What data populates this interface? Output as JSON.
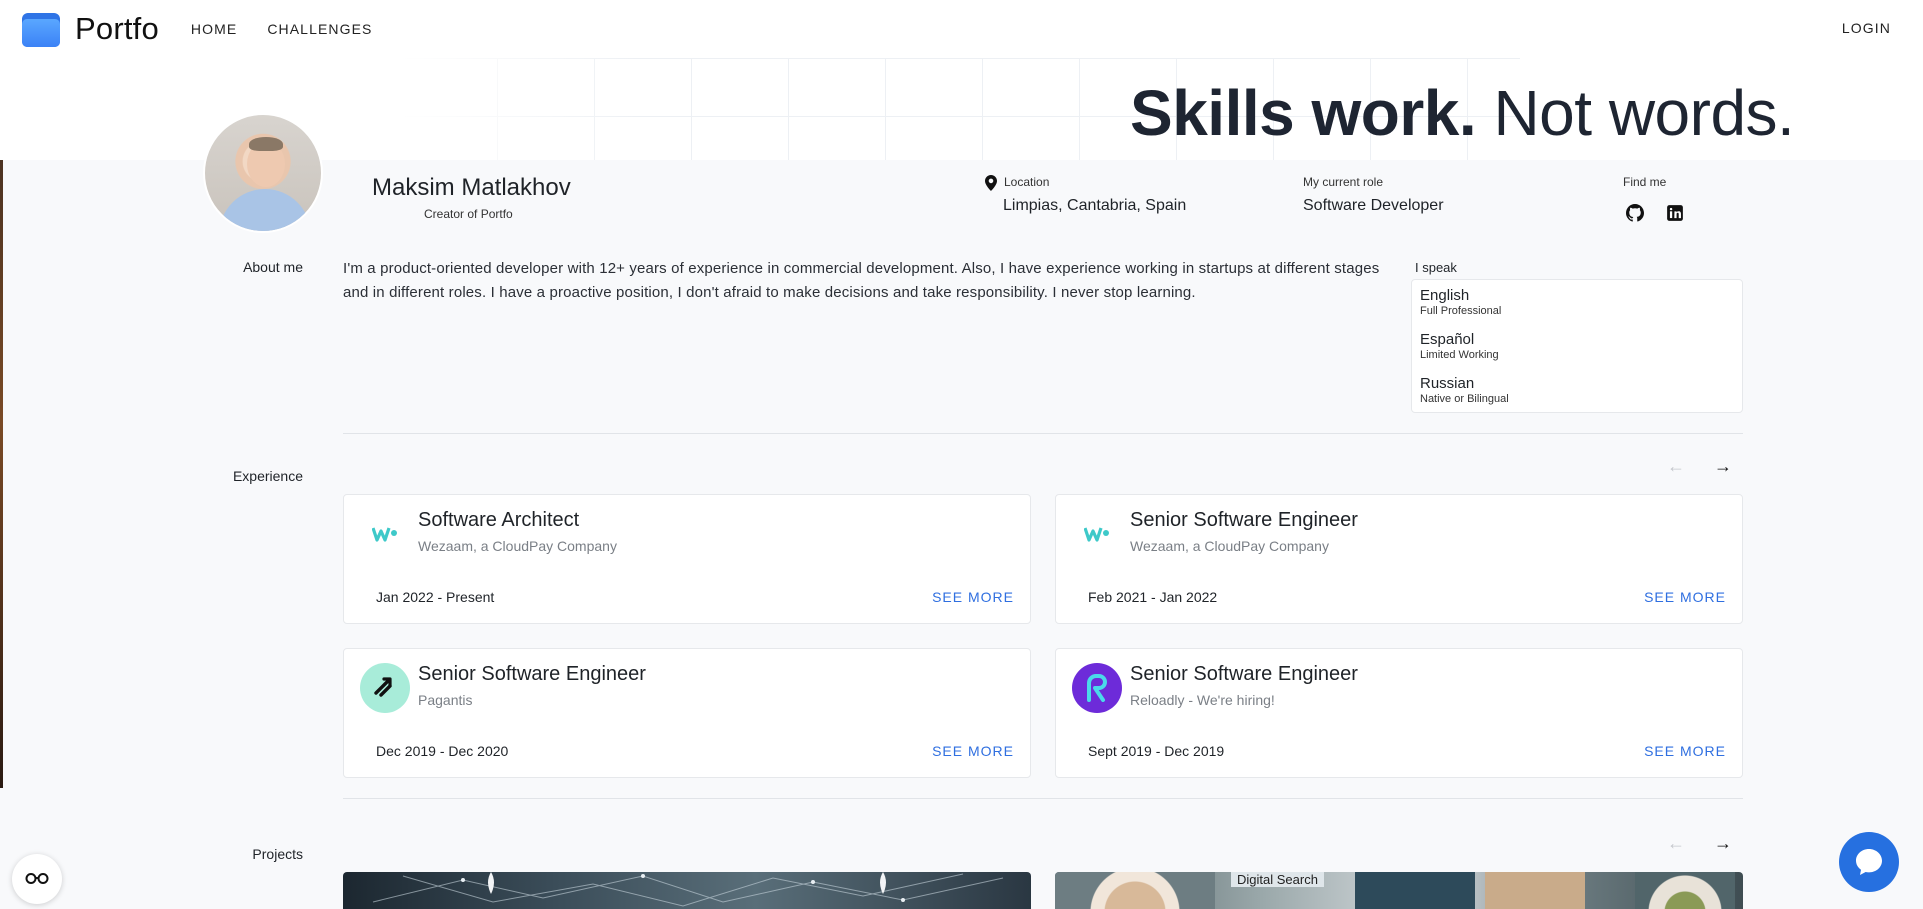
{
  "nav": {
    "brand": "Portfo",
    "links": [
      "HOME",
      "CHALLENGES"
    ],
    "login": "LOGIN"
  },
  "banner": {
    "bold": "Skills work.",
    "light": "Not words."
  },
  "profile": {
    "name": "Maksim Matlakhov",
    "subtitle": "Creator of Portfo",
    "location_label": "Location",
    "location_value": "Limpias, Cantabria, Spain",
    "role_label": "My current role",
    "role_value": "Software Developer",
    "find_label": "Find me",
    "social_icons": [
      "github-icon",
      "linkedin-icon"
    ]
  },
  "about": {
    "label": "About me",
    "text": "I'm a product-oriented developer with 12+ years of experience in commercial development. Also, I have experience working in startups at different stages and in different roles. I have a proactive position, I don't afraid to make decisions and take responsibility. I never stop learning."
  },
  "languages": {
    "label": "I speak",
    "items": [
      {
        "name": "English",
        "level": "Full Professional"
      },
      {
        "name": "Español",
        "level": "Limited Working"
      },
      {
        "name": "Russian",
        "level": "Native or Bilingual"
      }
    ]
  },
  "experience": {
    "label": "Experience",
    "see_more": "SEE MORE",
    "items": [
      {
        "title": "Software Architect",
        "company": "Wezaam, a CloudPay Company",
        "dates": "Jan 2022 - Present",
        "logo": "wezaam-logo"
      },
      {
        "title": "Senior Software Engineer",
        "company": "Wezaam, a CloudPay Company",
        "dates": "Feb 2021 - Jan 2022",
        "logo": "wezaam-logo"
      },
      {
        "title": "Senior Software Engineer",
        "company": "Pagantis",
        "dates": "Dec 2019 - Dec 2020",
        "logo": "pagantis-logo"
      },
      {
        "title": "Senior Software Engineer",
        "company": "Reloadly - We're hiring!",
        "dates": "Sept 2019 - Dec 2019",
        "logo": "reloadly-logo"
      }
    ]
  },
  "projects": {
    "label": "Projects",
    "thumb_text": "Digital Search"
  },
  "colors": {
    "accent": "#2f6fe0",
    "chat": "#2670e0",
    "wezaam": "#3ec9c9",
    "pagantis_bg": "#a8ecd9",
    "reloadly_bg": "#6d2bd9"
  }
}
